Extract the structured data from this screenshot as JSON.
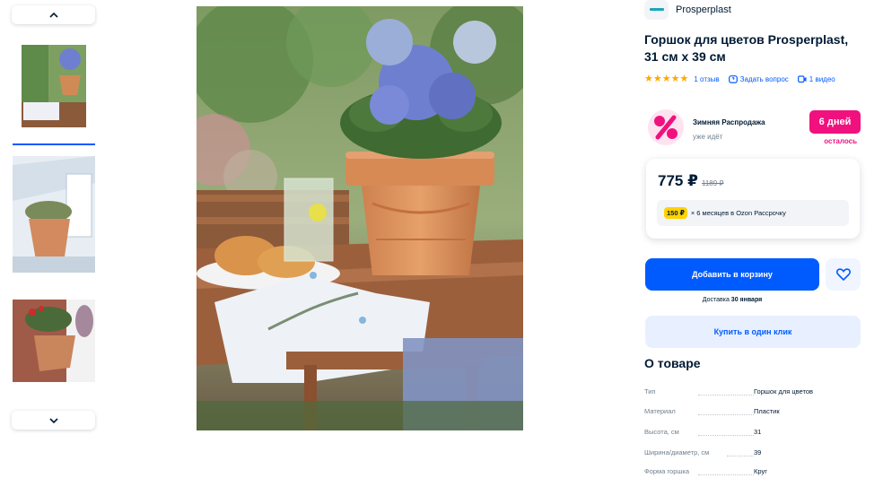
{
  "gallery": {
    "thumbnails": [
      "thumb-1",
      "thumb-2",
      "thumb-3"
    ],
    "active_index": 0
  },
  "brand": {
    "name": "Prosperplast"
  },
  "product": {
    "title": "Горшок для цветов Prosperplast, 31 см х 39 см",
    "rating_stars": 5,
    "reviews": "1 отзыв",
    "ask_question": "Задать вопрос",
    "videos": "1 видео"
  },
  "promo": {
    "title": "Зимняя Распродажа",
    "subtitle": "уже идёт",
    "badge": "6 дней",
    "badge_sub": "осталось"
  },
  "price": {
    "current": "775 ₽",
    "old": "1189 ₽",
    "installment_amount": "150 ₽",
    "installment_text": "× 6 месяцев в Ozon Рассрочку"
  },
  "actions": {
    "add_to_cart": "Добавить в корзину",
    "delivery_prefix": "Доставка ",
    "delivery_date": "30 января",
    "buy_one_click": "Купить в один клик"
  },
  "about": {
    "title": "О товаре",
    "specs": [
      {
        "key": "Тип",
        "value": "Горшок для цветов"
      },
      {
        "key": "Материал",
        "value": "Пластик"
      },
      {
        "key": "Высота, см",
        "value": "31"
      },
      {
        "key": "Ширина/диаметр, см",
        "value": "39"
      },
      {
        "key": "Форма горшка",
        "value": "Круг"
      }
    ]
  },
  "colors": {
    "accent": "#005bff",
    "promo": "#f1117e",
    "star": "#ffa800",
    "installment_badge": "#ffd200"
  }
}
